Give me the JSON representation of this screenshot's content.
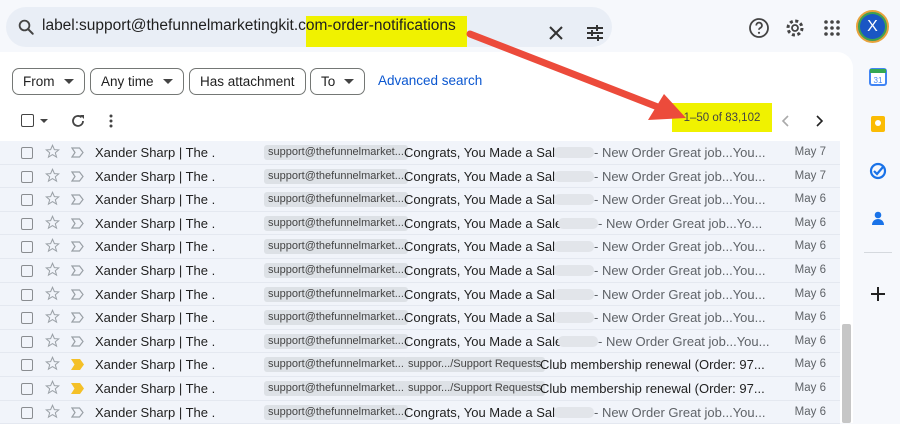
{
  "search": {
    "query_prefix": "label:support@thefunnelmarketingkit.com",
    "query_highlight": "-order-notifications"
  },
  "filters": {
    "from": "From",
    "any_time": "Any time",
    "has_attachment": "Has attachment",
    "to": "To",
    "advanced": "Advanced search"
  },
  "pagination": {
    "range": "1–50 of 83,102"
  },
  "avatar_letter": "X",
  "colors": {
    "highlight": "#f0f200",
    "arrow": "#ec4b3b",
    "link": "#0b57d0"
  },
  "rows": [
    {
      "sender": "Xander Sharp | The .",
      "label1": "support@thefunnelmarket...",
      "subject": "Congrats, You Made a Sale -",
      "snippet": "- New Order Great job...You...",
      "date": "May 7",
      "important": false
    },
    {
      "sender": "Xander Sharp | The .",
      "label1": "support@thefunnelmarket...",
      "subject": "Congrats, You Made a Sale -",
      "snippet": "- New Order Great job...You...",
      "date": "May 7",
      "important": false
    },
    {
      "sender": "Xander Sharp | The .",
      "label1": "support@thefunnelmarket...",
      "subject": "Congrats, You Made a Sale -",
      "snippet": "- New Order Great job...You...",
      "date": "May 6",
      "important": false
    },
    {
      "sender": "Xander Sharp | The .",
      "label1": "support@thefunnelmarket...",
      "subject": "Congrats, You Made a Sale -",
      "snippet": "- New Order Great job...Yo...",
      "date": "May 6",
      "important": false
    },
    {
      "sender": "Xander Sharp | The .",
      "label1": "support@thefunnelmarket...",
      "subject": "Congrats, You Made a Sale -",
      "snippet": "- New Order Great job...You...",
      "date": "May 6",
      "important": false
    },
    {
      "sender": "Xander Sharp | The .",
      "label1": "support@thefunnelmarket...",
      "subject": "Congrats, You Made a Sale -",
      "snippet": "- New Order Great job...You...",
      "date": "May 6",
      "important": false
    },
    {
      "sender": "Xander Sharp | The .",
      "label1": "support@thefunnelmarket...",
      "subject": "Congrats, You Made a Sale -",
      "snippet": "- New Order Great job...You...",
      "date": "May 6",
      "important": false
    },
    {
      "sender": "Xander Sharp | The .",
      "label1": "support@thefunnelmarket...",
      "subject": "Congrats, You Made a Sale -",
      "snippet": "- New Order Great job...You...",
      "date": "May 6",
      "important": false
    },
    {
      "sender": "Xander Sharp | The .",
      "label1": "support@thefunnelmarket...",
      "subject": "Congrats, You Made a Sale -",
      "snippet": "- New Order Great job...You...",
      "date": "May 6",
      "important": false
    },
    {
      "sender": "Xander Sharp | The .",
      "label1": "support@thefunnelmarket...",
      "label2": "suppor.../Support Requests",
      "subject2": "Club membership renewal (Order: 97...",
      "date": "May 6",
      "important": true
    },
    {
      "sender": "Xander Sharp | The .",
      "label1": "support@thefunnelmarket...",
      "label2": "suppor.../Support Requests",
      "subject2": "Club membership renewal (Order: 97...",
      "date": "May 6",
      "important": true
    },
    {
      "sender": "Xander Sharp | The .",
      "label1": "support@thefunnelmarket...",
      "subject": "Congrats, You Made a Sale -",
      "snippet": "- New Order Great job...You...",
      "date": "May 6",
      "important": false
    }
  ]
}
